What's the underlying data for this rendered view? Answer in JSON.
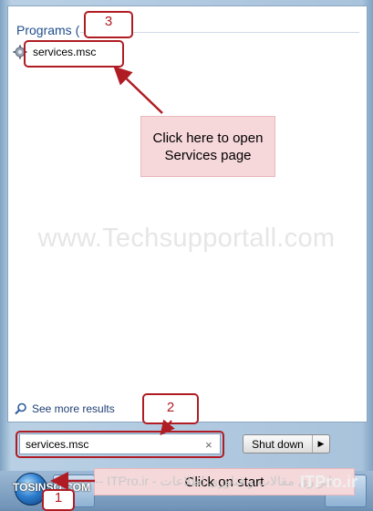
{
  "start_menu": {
    "programs_header": "Programs (",
    "result_item": "services.msc",
    "see_more": "See more results",
    "search_value": "services.msc",
    "clear_glyph": "×",
    "shutdown_label": "Shut down",
    "shutdown_arrow": "▶"
  },
  "annotations": {
    "step1": "1",
    "step2": "2",
    "step3": "3",
    "callout_line1": "Click here to open",
    "callout_line2": "Services page",
    "bottom_note": "Click on start",
    "accent": "#b01c24",
    "callout_bg": "#f6d7da"
  },
  "watermarks": {
    "center": "www.Techsupportall.com",
    "left_logo": "TOSINSO.COM",
    "right_logo": "ITPro.ir",
    "overlay_text": "-- ITPro.ir - ابزاری مقالات و فناوری اطلاعات"
  },
  "icons": {
    "result_icon": "gear-icon",
    "see_more_icon": "magnifier-icon",
    "start_icon": "windows-orb-icon"
  }
}
